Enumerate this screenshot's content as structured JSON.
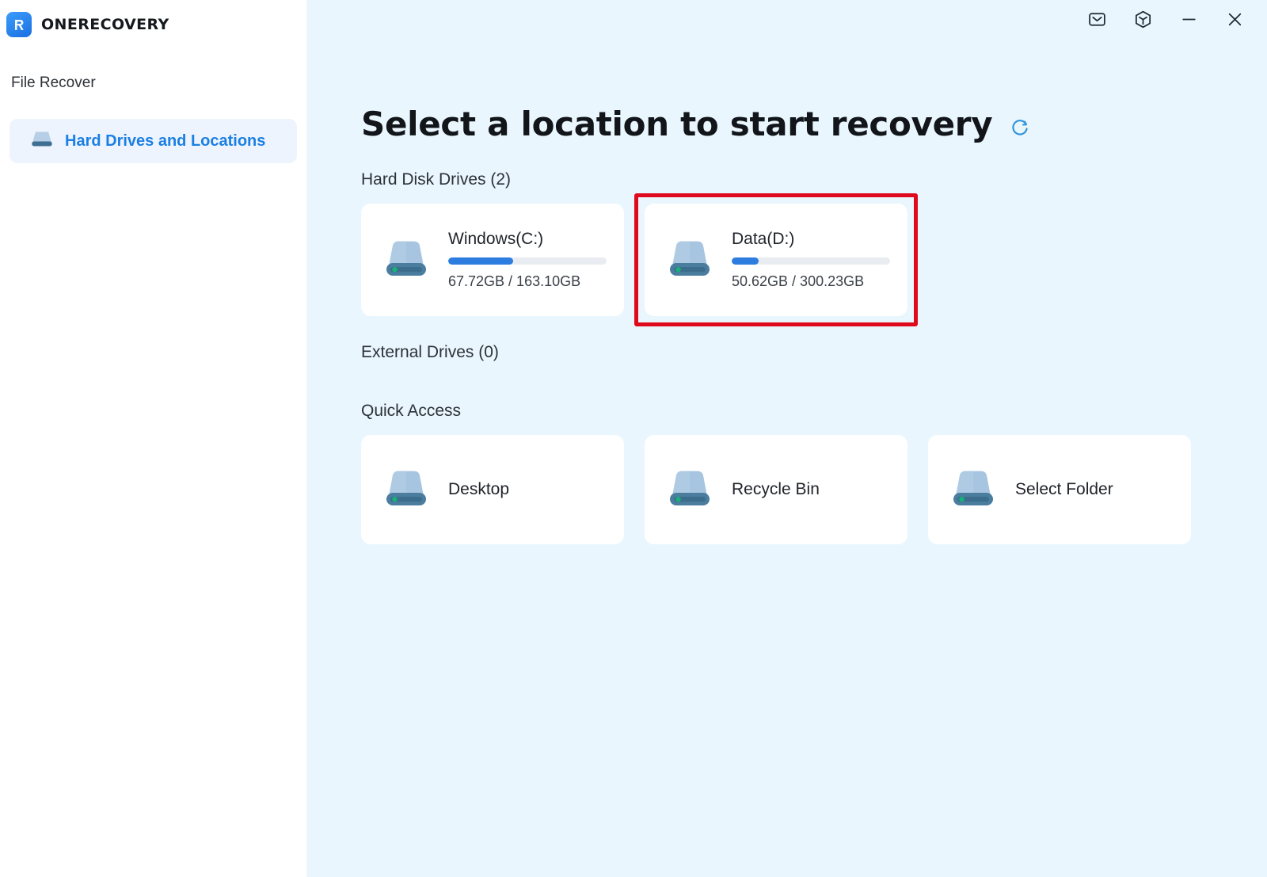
{
  "app": {
    "brand_name": "ONERECOVERY",
    "logo_icon": "onerecovery-logo-icon"
  },
  "titlebar": {
    "buttons": [
      {
        "name": "mail-icon",
        "label": "Mail"
      },
      {
        "name": "cube-icon",
        "label": "Cube"
      },
      {
        "name": "minimize-icon",
        "label": "Minimize"
      },
      {
        "name": "close-icon",
        "label": "Close"
      }
    ]
  },
  "sidebar": {
    "section_title": "File Recover",
    "items": [
      {
        "label": "Hard Drives and Locations",
        "icon": "hard-drive-icon",
        "active": true
      }
    ]
  },
  "main": {
    "page_title": "Select a location to start recovery",
    "refresh_icon": "refresh-icon",
    "sections": {
      "hard_disk_drives": {
        "label": "Hard Disk Drives (2)",
        "count": 2,
        "drives": [
          {
            "name": "Windows(C:)",
            "used": "67.72GB",
            "total": "163.10GB",
            "usage_text": "67.72GB / 163.10GB",
            "percent": 41,
            "icon": "hard-drive-icon",
            "highlighted": false
          },
          {
            "name": "Data(D:)",
            "used": "50.62GB",
            "total": "300.23GB",
            "usage_text": "50.62GB / 300.23GB",
            "percent": 17,
            "icon": "hard-drive-icon",
            "highlighted": true
          }
        ]
      },
      "external_drives": {
        "label": "External Drives (0)",
        "count": 0,
        "drives": []
      },
      "quick_access": {
        "label": "Quick Access",
        "items": [
          {
            "name": "Desktop",
            "icon": "hard-drive-icon"
          },
          {
            "name": "Recycle Bin",
            "icon": "hard-drive-icon"
          },
          {
            "name": "Select Folder",
            "icon": "folder-drive-icon"
          }
        ]
      }
    }
  },
  "colors": {
    "accent_blue": "#2d7ce0",
    "link_blue": "#1b7fe3",
    "main_background": "#eaf6fd",
    "sidebar_background": "#ffffff",
    "card_background": "#ffffff",
    "highlight_red": "#e00a1e",
    "bar_track": "#e9edf2",
    "drive_led_green": "#18b07a"
  }
}
